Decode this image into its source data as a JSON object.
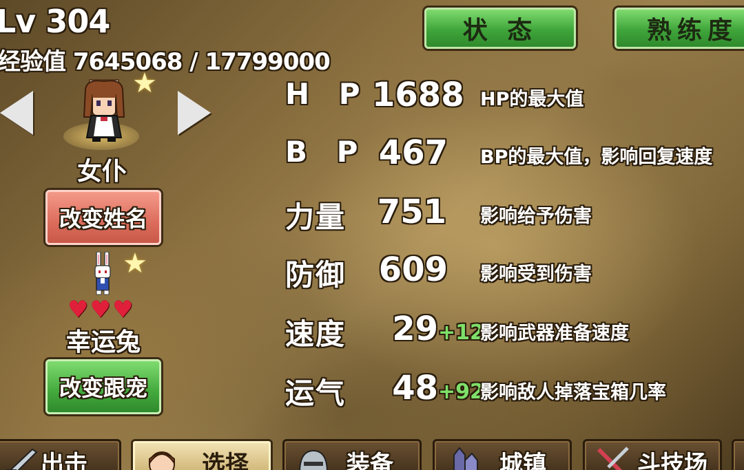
{
  "header": {
    "level": "Lv 304",
    "exp": "经验值 7645068 / 17799000"
  },
  "tabs": {
    "status": "状 态",
    "proficiency": "熟练度"
  },
  "character": {
    "class_name": "女仆",
    "rename_button": "改变姓名"
  },
  "pet": {
    "hearts": "♥♥♥",
    "name": "幸运兔",
    "change_button": "改变跟宠"
  },
  "stats": [
    {
      "label": "H P",
      "value": "1688",
      "bonus": "",
      "desc": "HP的最大值"
    },
    {
      "label": "B P",
      "value": "467",
      "bonus": "",
      "desc": "BP的最大值，影响回复速度"
    },
    {
      "label": "力量",
      "value": "751",
      "bonus": "",
      "desc": "影响给予伤害"
    },
    {
      "label": "防御",
      "value": "609",
      "bonus": "",
      "desc": "影响受到伤害"
    },
    {
      "label": "速度",
      "value": "29",
      "bonus": "+12",
      "desc": "影响武器准备速度"
    },
    {
      "label": "运气",
      "value": "48",
      "bonus": "+92",
      "desc": "影响敌人掉落宝箱几率"
    }
  ],
  "bottom_nav": {
    "sortie": "出击",
    "select": "选择",
    "equip": "装备",
    "town": "城镇",
    "arena": "斗技场"
  },
  "colors": {
    "tab_green": "#3fa53a",
    "rename_red": "#dc6c5c",
    "bonus_green": "#7ee06a",
    "heart_red": "#e0203a"
  },
  "icons": [
    "arrow-left-icon",
    "arrow-right-icon",
    "star-icon",
    "maid-sprite",
    "rabbit-sprite",
    "heart-icon"
  ]
}
